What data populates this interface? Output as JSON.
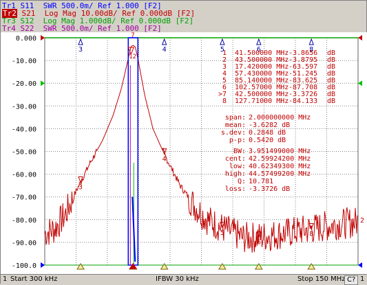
{
  "traces": [
    {
      "id": "tr1",
      "tag": "Tr1",
      "text": "S11  SWR 500.0m/ Ref 1.000 [F2]",
      "color": "#0000ff",
      "active": false
    },
    {
      "id": "tr2",
      "tag": "Tr2",
      "text": "S21  Log Mag 10.00dB/ Ref 0.000dB [F2]",
      "color": "#c00000",
      "active": true
    },
    {
      "id": "tr3",
      "tag": "Tr3",
      "text": "S12  Log Mag 1.000dB/ Ref 0.000dB [F2]",
      "color": "#00a000",
      "active": false
    },
    {
      "id": "tr4",
      "tag": "Tr4",
      "text": "S22  SWR 500.0m/ Ref 1.000 [F2]",
      "color": "#a000a0",
      "active": false
    }
  ],
  "colors": {
    "s21": "#c00000",
    "s11": "#0000ff",
    "s12": "#00c000",
    "s22": "#a000a0",
    "grid": "#808080",
    "marker_top": "#0000a0"
  },
  "y_labels": [
    "0.000",
    "-10.00",
    "-20.00",
    "-30.00",
    "-40.00",
    "-50.00",
    "-60.00",
    "-70.00",
    "-80.00",
    "-90.00",
    "-100.0"
  ],
  "marker_table": [
    {
      "id": "1",
      "freq": "41.500000 MHz",
      "val": "-3.8656",
      "unit": "dB"
    },
    {
      "id": "2",
      "freq": "43.500000 MHz",
      "val": "-3.8795",
      "unit": "dB"
    },
    {
      "id": "3",
      "freq": "17.420000 MHz",
      "val": "-63.597",
      "unit": "dB"
    },
    {
      "id": "4",
      "freq": "57.430000 MHz",
      "val": "-51.245",
      "unit": "dB"
    },
    {
      "id": "5",
      "freq": "85.140000 MHz",
      "val": "-83.625",
      "unit": "dB"
    },
    {
      "id": "6",
      "freq": "102.57000 MHz",
      "val": "-87.708",
      "unit": "dB"
    },
    {
      "id": ">7",
      "freq": "42.500000 MHz",
      "val": "-3.3726",
      "unit": "dB"
    },
    {
      "id": "8",
      "freq": "127.71000 MHz",
      "val": "-84.133",
      "unit": "dB"
    }
  ],
  "stats": [
    {
      "label": "span:",
      "value": "2.000000000 MHz"
    },
    {
      "label": "mean:",
      "value": "-3.6282 dB"
    },
    {
      "label": "s.dev:",
      "value": "0.2848 dB"
    },
    {
      "label": "p-p:",
      "value": "0.5420 dB"
    }
  ],
  "bw": [
    {
      "label": "BW:",
      "value": "3.951499000 MHz"
    },
    {
      "label": "cent:",
      "value": "42.59924200 MHz"
    },
    {
      "label": "low:",
      "value": "40.62349300 MHz"
    },
    {
      "label": "high:",
      "value": "44.57499200 MHz"
    },
    {
      "label": "Q:",
      "value": "10.781"
    },
    {
      "label": "loss:",
      "value": "-3.3726 dB"
    }
  ],
  "markers_top": [
    "3",
    "4",
    "5",
    "6",
    "8"
  ],
  "markers_peak": [
    "7",
    "1",
    "2"
  ],
  "markers_trace": [
    "3",
    "4",
    "5",
    "6",
    "8"
  ],
  "right_label": "2",
  "status": {
    "channel": "1",
    "start": "Start 300 kHz",
    "ifbw": "IFBW 30 kHz",
    "stop": "Stop 150 MHz",
    "cal": "C?",
    "arrow": "1"
  },
  "chart_data": {
    "type": "line",
    "x_range_mhz": [
      0.3,
      150
    ],
    "ylim": [
      -100,
      0
    ],
    "series": [
      {
        "name": "S21",
        "points": [
          [
            0.3,
            -86
          ],
          [
            5,
            -84
          ],
          [
            10,
            -78
          ],
          [
            15,
            -68
          ],
          [
            17.42,
            -63.597
          ],
          [
            22,
            -55
          ],
          [
            28,
            -45
          ],
          [
            33,
            -34
          ],
          [
            37,
            -22
          ],
          [
            40,
            -10
          ],
          [
            41.5,
            -3.8656
          ],
          [
            42.5,
            -3.3726
          ],
          [
            43.5,
            -3.8795
          ],
          [
            45,
            -10
          ],
          [
            48,
            -25
          ],
          [
            52,
            -40
          ],
          [
            57.43,
            -51.245
          ],
          [
            65,
            -65
          ],
          [
            72,
            -74
          ],
          [
            78,
            -80
          ],
          [
            85.14,
            -83.625
          ],
          [
            95,
            -88
          ],
          [
            102.57,
            -87.708
          ],
          [
            115,
            -86
          ],
          [
            127.71,
            -84.133
          ],
          [
            140,
            -82
          ],
          [
            150,
            -81
          ]
        ]
      }
    ]
  }
}
